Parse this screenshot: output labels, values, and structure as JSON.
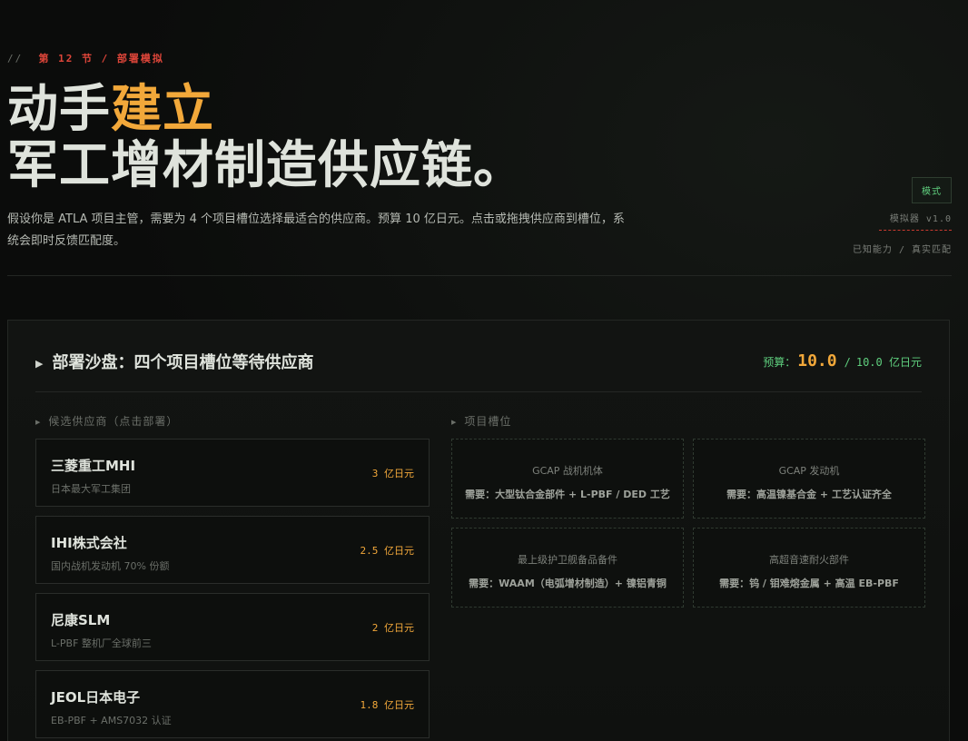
{
  "header": {
    "kicker_prefix": "//",
    "kicker": "第 12 节 / 部署模拟",
    "title_line1_plain": "动手",
    "title_line1_accent": "建立",
    "title_line2": "军工增材制造供应链。",
    "intro": "假设你是 ATLA 项目主管，需要为 4 个项目槽位选择最适合的供应商。预算 10 亿日元。点击或拖拽供应商到槽位，系统会即时反馈匹配度。"
  },
  "side_meta": {
    "mode_button": "模式",
    "version": "模拟器 v1.0",
    "subtitle": "已知能力 / 真实匹配"
  },
  "panel": {
    "title": "部署沙盘：四个项目槽位等待供应商",
    "budget_label": "预算：",
    "budget_current": "10.0",
    "budget_total": "10.0",
    "budget_unit": "亿日元"
  },
  "suppliers_label": "候选供应商（点击部署）",
  "slots_label": "项目槽位",
  "suppliers": [
    {
      "name": "三菱重工MHI",
      "desc": "日本最大军工集团",
      "price": "3 亿日元"
    },
    {
      "name": "IHI株式会社",
      "desc": "国内战机发动机 70% 份额",
      "price": "2.5 亿日元"
    },
    {
      "name": "尼康SLM",
      "desc": "L-PBF 整机厂全球前三",
      "price": "2 亿日元"
    },
    {
      "name": "JEOL日本电子",
      "desc": "EB-PBF + AMS7032 认证",
      "price": "1.8 亿日元"
    }
  ],
  "slots": [
    {
      "name": "GCAP 战机机体",
      "req": "需要：大型钛合金部件 + L-PBF / DED 工艺"
    },
    {
      "name": "GCAP 发动机",
      "req": "需要：高温镍基合金 + 工艺认证齐全"
    },
    {
      "name": "最上级护卫舰备品备件",
      "req": "需要：WAAM（电弧增材制造）+ 镍铝青铜"
    },
    {
      "name": "高超音速耐火部件",
      "req": "需要：钨 / 钼难熔金属 + 高温 EB-PBF"
    }
  ]
}
